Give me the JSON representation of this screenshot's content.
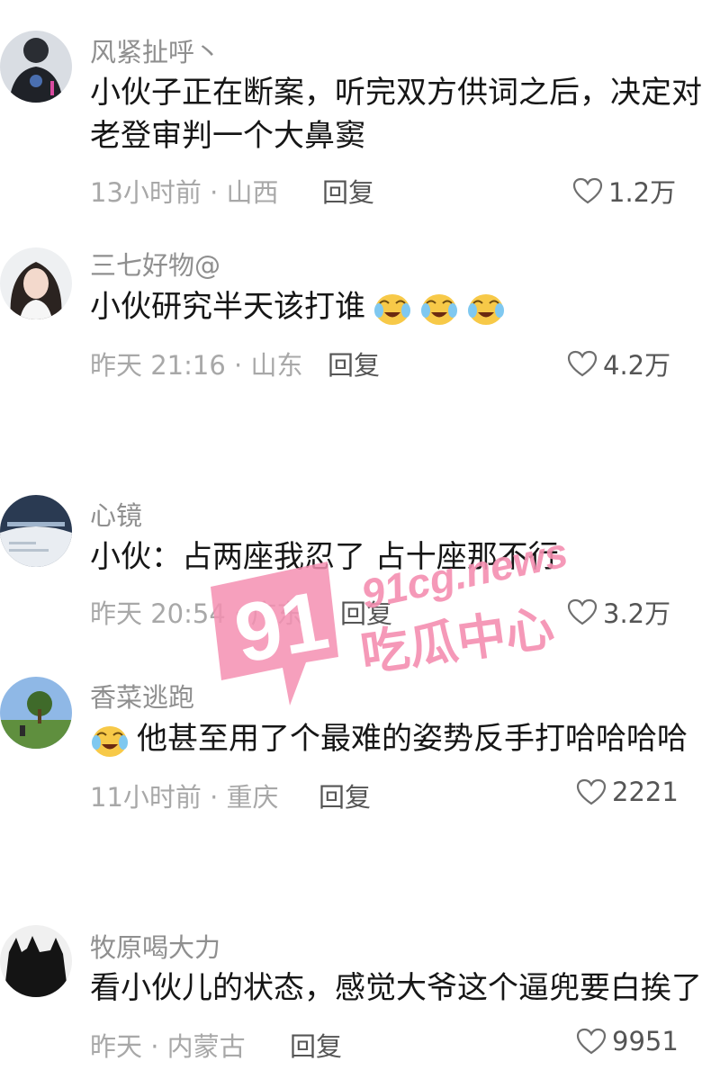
{
  "comments": [
    {
      "username": "风紧扯呼丶",
      "lines": [
        "小伙子正在断案，听完双方供词之后，决定对",
        "老登审判一个大鼻窦"
      ],
      "meta": "13小时前 · 山西",
      "reply": "回复",
      "likes": "1.2万"
    },
    {
      "username": "三七好物@",
      "lines": [
        "小伙研究半天该打谁"
      ],
      "meta": "昨天 21:16 · 山东",
      "reply": "回复",
      "likes": "4.2万"
    },
    {
      "username": "心镜",
      "lines": [
        "小伙：占两座我忍了 占十座那不行"
      ],
      "meta": "昨天 20:54 · 广东",
      "reply": "回复",
      "likes": "3.2万"
    },
    {
      "username": "香菜逃跑",
      "lines": [
        "他甚至用了个最难的姿势反手打哈哈哈哈"
      ],
      "meta": "11小时前 · 重庆",
      "reply": "回复",
      "likes": "2221"
    },
    {
      "username": "牧原喝大力",
      "lines": [
        "看小伙儿的状态，感觉大爷这个逼兜要白挨了"
      ],
      "meta": "昨天 · 内蒙古",
      "reply": "回复",
      "likes": "9951"
    }
  ],
  "watermark": {
    "number": "91",
    "domain": "91cg.news",
    "name": "吃瓜中心"
  },
  "colors": {
    "username": "#8f8f8f",
    "text": "#161616",
    "meta": "#a8a8a8",
    "watermark": "#f48fb1"
  }
}
